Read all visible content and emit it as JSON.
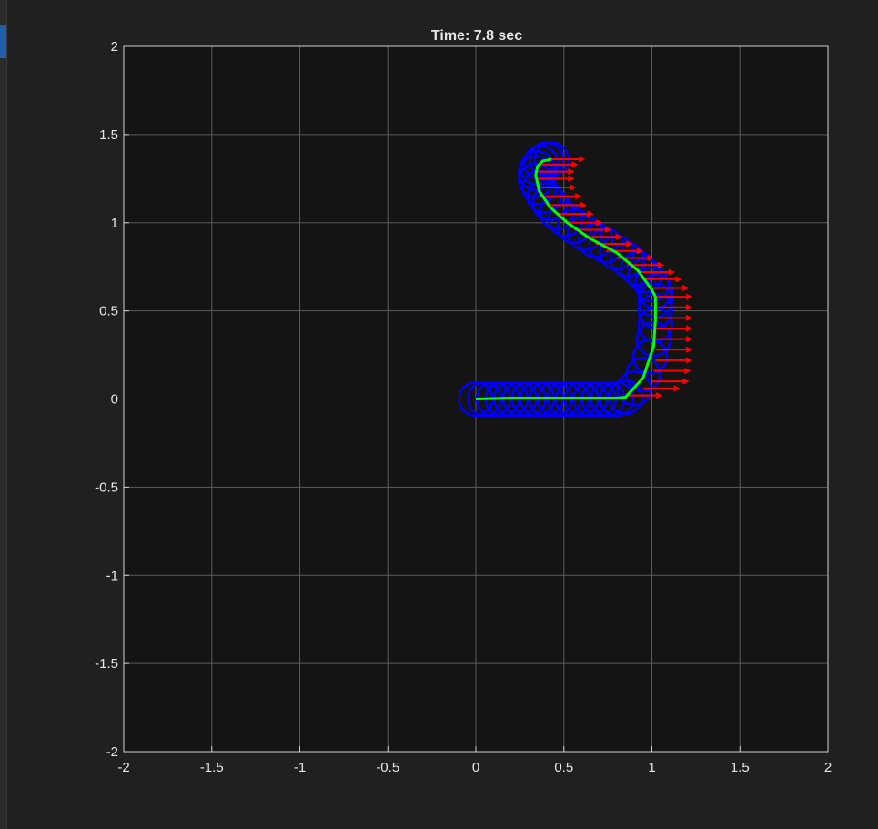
{
  "figure": {
    "title": "Time: 7.8 sec",
    "background_color": "#202020",
    "axes_color": "#141414",
    "grid_color": "#5a5a5a",
    "text_color": "#e6e6e6"
  },
  "chart_data": {
    "type": "line",
    "title": "Time: 7.8 sec",
    "xlabel": "",
    "ylabel": "",
    "xlim": [
      -2,
      2
    ],
    "ylim": [
      -2,
      2
    ],
    "x_ticks": [
      "-2",
      "-1.5",
      "-1",
      "-0.5",
      "0",
      "0.5",
      "1",
      "1.5",
      "2"
    ],
    "y_ticks": [
      "2",
      "1.5",
      "1",
      "0.5",
      "0",
      "-0.5",
      "-1",
      "-1.5",
      "-2"
    ],
    "grid": true,
    "legend": "none",
    "series": [
      {
        "role": "trajectory",
        "color": "#00ff00",
        "x": [
          0,
          0.2,
          0.4,
          0.6,
          0.8,
          0.85,
          0.95,
          1.01,
          1.02,
          1.02,
          1.0,
          0.92,
          0.8,
          0.65,
          0.52,
          0.42,
          0.36,
          0.34,
          0.35,
          0.38,
          0.43
        ],
        "y": [
          0,
          0.005,
          0.005,
          0.005,
          0.005,
          0.01,
          0.12,
          0.3,
          0.45,
          0.58,
          0.62,
          0.73,
          0.83,
          0.91,
          1.0,
          1.09,
          1.18,
          1.27,
          1.32,
          1.35,
          1.36
        ]
      },
      {
        "role": "robot-footprint",
        "color": "#0000ff",
        "marker": "circle",
        "x": [
          0,
          0.05,
          0.1,
          0.15,
          0.2,
          0.25,
          0.3,
          0.35,
          0.4,
          0.45,
          0.5,
          0.55,
          0.6,
          0.65,
          0.7,
          0.75,
          0.8,
          0.85,
          0.9,
          0.95,
          0.99,
          1.01,
          1.02,
          1.02,
          1.02,
          1.02,
          1.0,
          0.96,
          0.92,
          0.86,
          0.8,
          0.74,
          0.68,
          0.62,
          0.56,
          0.51,
          0.46,
          0.42,
          0.39,
          0.36,
          0.34,
          0.34,
          0.35,
          0.37,
          0.4,
          0.43
        ],
        "y": [
          0,
          0,
          0,
          0,
          0,
          0,
          0,
          0,
          0,
          0,
          0,
          0,
          0,
          0,
          0,
          0,
          0,
          0.01,
          0.06,
          0.14,
          0.24,
          0.34,
          0.42,
          0.5,
          0.56,
          0.61,
          0.65,
          0.7,
          0.74,
          0.79,
          0.83,
          0.87,
          0.9,
          0.94,
          0.98,
          1.02,
          1.06,
          1.11,
          1.15,
          1.2,
          1.24,
          1.28,
          1.31,
          1.34,
          1.36,
          1.36
        ]
      },
      {
        "role": "heading-arrows",
        "color": "#ff0000",
        "direction": "+x",
        "x": [
          0.85,
          0.95,
          1.0,
          1.01,
          1.02,
          1.02,
          1.02,
          1.02,
          1.02,
          1.02,
          1.02,
          1.0,
          0.96,
          0.92,
          0.86,
          0.8,
          0.74,
          0.68,
          0.62,
          0.56,
          0.51,
          0.46,
          0.42,
          0.39,
          0.36,
          0.35,
          0.35,
          0.37,
          0.41
        ],
        "y": [
          0.02,
          0.06,
          0.1,
          0.16,
          0.22,
          0.28,
          0.34,
          0.4,
          0.46,
          0.52,
          0.58,
          0.63,
          0.68,
          0.72,
          0.76,
          0.8,
          0.84,
          0.88,
          0.92,
          0.96,
          1.0,
          1.05,
          1.1,
          1.15,
          1.2,
          1.25,
          1.29,
          1.33,
          1.36
        ]
      }
    ]
  }
}
